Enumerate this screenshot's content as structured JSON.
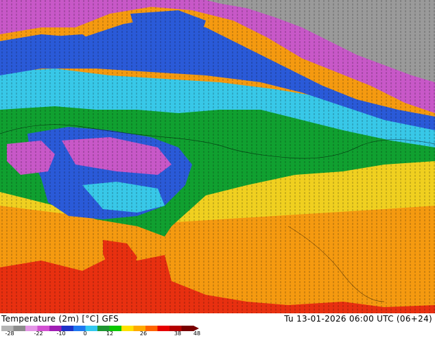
{
  "header": {
    "title": "Temperature (2m) [°C] GFS",
    "time": "Tu 13-01-2026 06:00 UTC (06+24)"
  },
  "legend": {
    "ticks": [
      "-28",
      "-22",
      "-10",
      "0",
      "12",
      "26",
      "38",
      "48"
    ],
    "colors": [
      "#b4b4b4",
      "#8c8c8c",
      "#e496e6",
      "#d250d2",
      "#a01eb4",
      "#1e32c8",
      "#1e78f0",
      "#32c8f0",
      "#1e9632",
      "#0ac800",
      "#ffe100",
      "#ffaa00",
      "#ff6400",
      "#e60000",
      "#b40000",
      "#780000"
    ]
  },
  "map": {
    "zones": [
      {
        "name": "arctic",
        "color": "#9a9a9a"
      },
      {
        "name": "very-cold",
        "color": "#c858c8"
      },
      {
        "name": "cold",
        "color": "#2a5ad8"
      },
      {
        "name": "cool",
        "color": "#38c8e8"
      },
      {
        "name": "mild",
        "color": "#10a030"
      },
      {
        "name": "warm",
        "color": "#f0d020"
      },
      {
        "name": "hot",
        "color": "#f59a10"
      },
      {
        "name": "very-hot",
        "color": "#e83010"
      }
    ]
  }
}
